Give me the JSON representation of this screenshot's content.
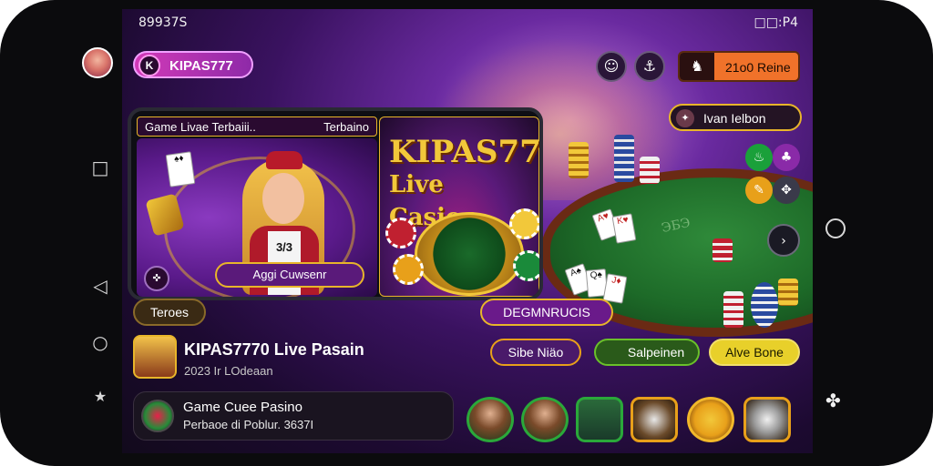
{
  "status_bar": {
    "left_text": "89937S",
    "left_icons": [
      "gallery-icon",
      "doc-icon",
      "message-icon",
      "app-icon"
    ],
    "right_text": "□□:P4"
  },
  "header": {
    "brand_label": "KIPAS777",
    "brand_icon": "K",
    "top_icons": [
      "user-icon",
      "anchor-icon"
    ],
    "balance_label": "21o0 Reine",
    "balance_icon": "♞"
  },
  "live_button": {
    "label": "Ivan Ielbon",
    "icon": "✦"
  },
  "promo_device": {
    "top_bar_left": "Game Livae Terbaiii..",
    "top_bar_right": "Terbaino",
    "dealer_vest_text": "3/3",
    "bottom_button": "Aggi Cuwsenr",
    "small_icon": "✜",
    "promo_title_line1": "KIPAS777",
    "promo_title_line2": "Live Casion"
  },
  "tags": {
    "left_pill": "Teroes",
    "center_pill": "DEGMNRUCIS",
    "pill_a": "Sibe Niäo",
    "pill_b": "Salpeinen",
    "pill_c": "Alve Bone"
  },
  "felt": {
    "watermark": "ЭБЭ"
  },
  "game_row": {
    "title": "KIPAS7770 Live Pasain",
    "subtitle": "2023 Ir LOdeaan"
  },
  "bottom_panel": {
    "title": "Game Cuee Pasino",
    "subtitle": "Perbaoe di Poblur. 3637I"
  },
  "nav": {
    "square": "□",
    "back": "◁",
    "search": "○",
    "star": "★"
  },
  "right_float_icon": "✤",
  "colors": {
    "accent_purple": "#8e2aa8",
    "accent_gold": "#e8b52a",
    "balance_orange": "#f0722a",
    "felt_green": "#1d6a28"
  }
}
